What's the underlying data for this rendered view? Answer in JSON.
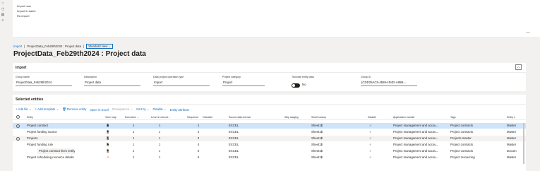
{
  "top_panel": {
    "menu_items": [
      "Import now",
      "Import in batch",
      "Re-import"
    ]
  },
  "breadcrumb": {
    "first": "Import",
    "second": "ProjectData_Feb29th2024 : Project data",
    "view": "Standard view"
  },
  "page_title": "ProjectData_Feb29th2024 : Project data",
  "import_section": {
    "title": "Import",
    "fields": {
      "group_name": {
        "label": "Group name",
        "value": "ProjectData_Feb29th2024"
      },
      "description": {
        "label": "Description",
        "value": "Project data"
      },
      "operation_type": {
        "label": "Data project operation type",
        "value": "Import"
      },
      "category": {
        "label": "Project category",
        "value": "Project"
      },
      "truncate": {
        "label": "Truncate entity data",
        "value": "No"
      },
      "group_id": {
        "label": "Group ID",
        "value": "{CDD25AC5-4559-4D4D-A85B-..."
      }
    }
  },
  "entities_section": {
    "title": "Selected entities",
    "toolbar": {
      "add_file": "+ Add file",
      "add_template": "+ Add template",
      "remove_entity": "Remove entity",
      "open_excel": "Open in Excel",
      "resequence": "Resequence",
      "sort_by": "Sort by",
      "disable": "Disable",
      "entity_attribute": "Entity attribute"
    },
    "columns": [
      "Entity",
      "View map",
      "Execution ...",
      "Level in execut...",
      "Sequence",
      "Obsolete",
      "Source data format",
      "Skip staging",
      "Sheet lookup",
      "Disable",
      "Application module",
      "Tags",
      "Entity c"
    ],
    "rows": [
      {
        "entity": "Project contract",
        "level": "1",
        "exec": "1",
        "seq": "1",
        "format": "EXCEL",
        "sheet": "Sheet1$",
        "module": "Project management and accou...",
        "tags": "Project contracts",
        "cat": "Master"
      },
      {
        "entity": "Project funding source",
        "level": "1",
        "exec": "1",
        "seq": "2",
        "format": "EXCEL",
        "sheet": "Sheet1$",
        "module": "Project management and accou...",
        "tags": "Project contracts",
        "cat": "Master"
      },
      {
        "entity": "Projects",
        "level": "1",
        "exec": "1",
        "seq": "3",
        "format": "EXCEL",
        "sheet": "Sheet1$",
        "module": "Project management and accou...",
        "tags": "Projects master",
        "cat": "Master"
      },
      {
        "entity": "Project funding rule",
        "level": "1",
        "exec": "1",
        "seq": "4",
        "format": "EXCEL",
        "sheet": "Sheet1$",
        "module": "Project management and accou...",
        "tags": "Project contracts",
        "cat": "Master"
      },
      {
        "entity": "Project contract lines entity",
        "level": "1",
        "exec": "1",
        "seq": "5",
        "format": "EXCEL",
        "sheet": "Sheet1$",
        "module": "Project management and accou...",
        "tags": "Project contracts",
        "cat": "Docum"
      },
      {
        "entity": "Project scheduling resource details",
        "level": "1",
        "exec": "1",
        "seq": "6",
        "format": "EXCEL",
        "sheet": "Sheet1$",
        "module": "Project management and accou...",
        "tags": "Project resourcing",
        "cat": "Master"
      }
    ]
  }
}
